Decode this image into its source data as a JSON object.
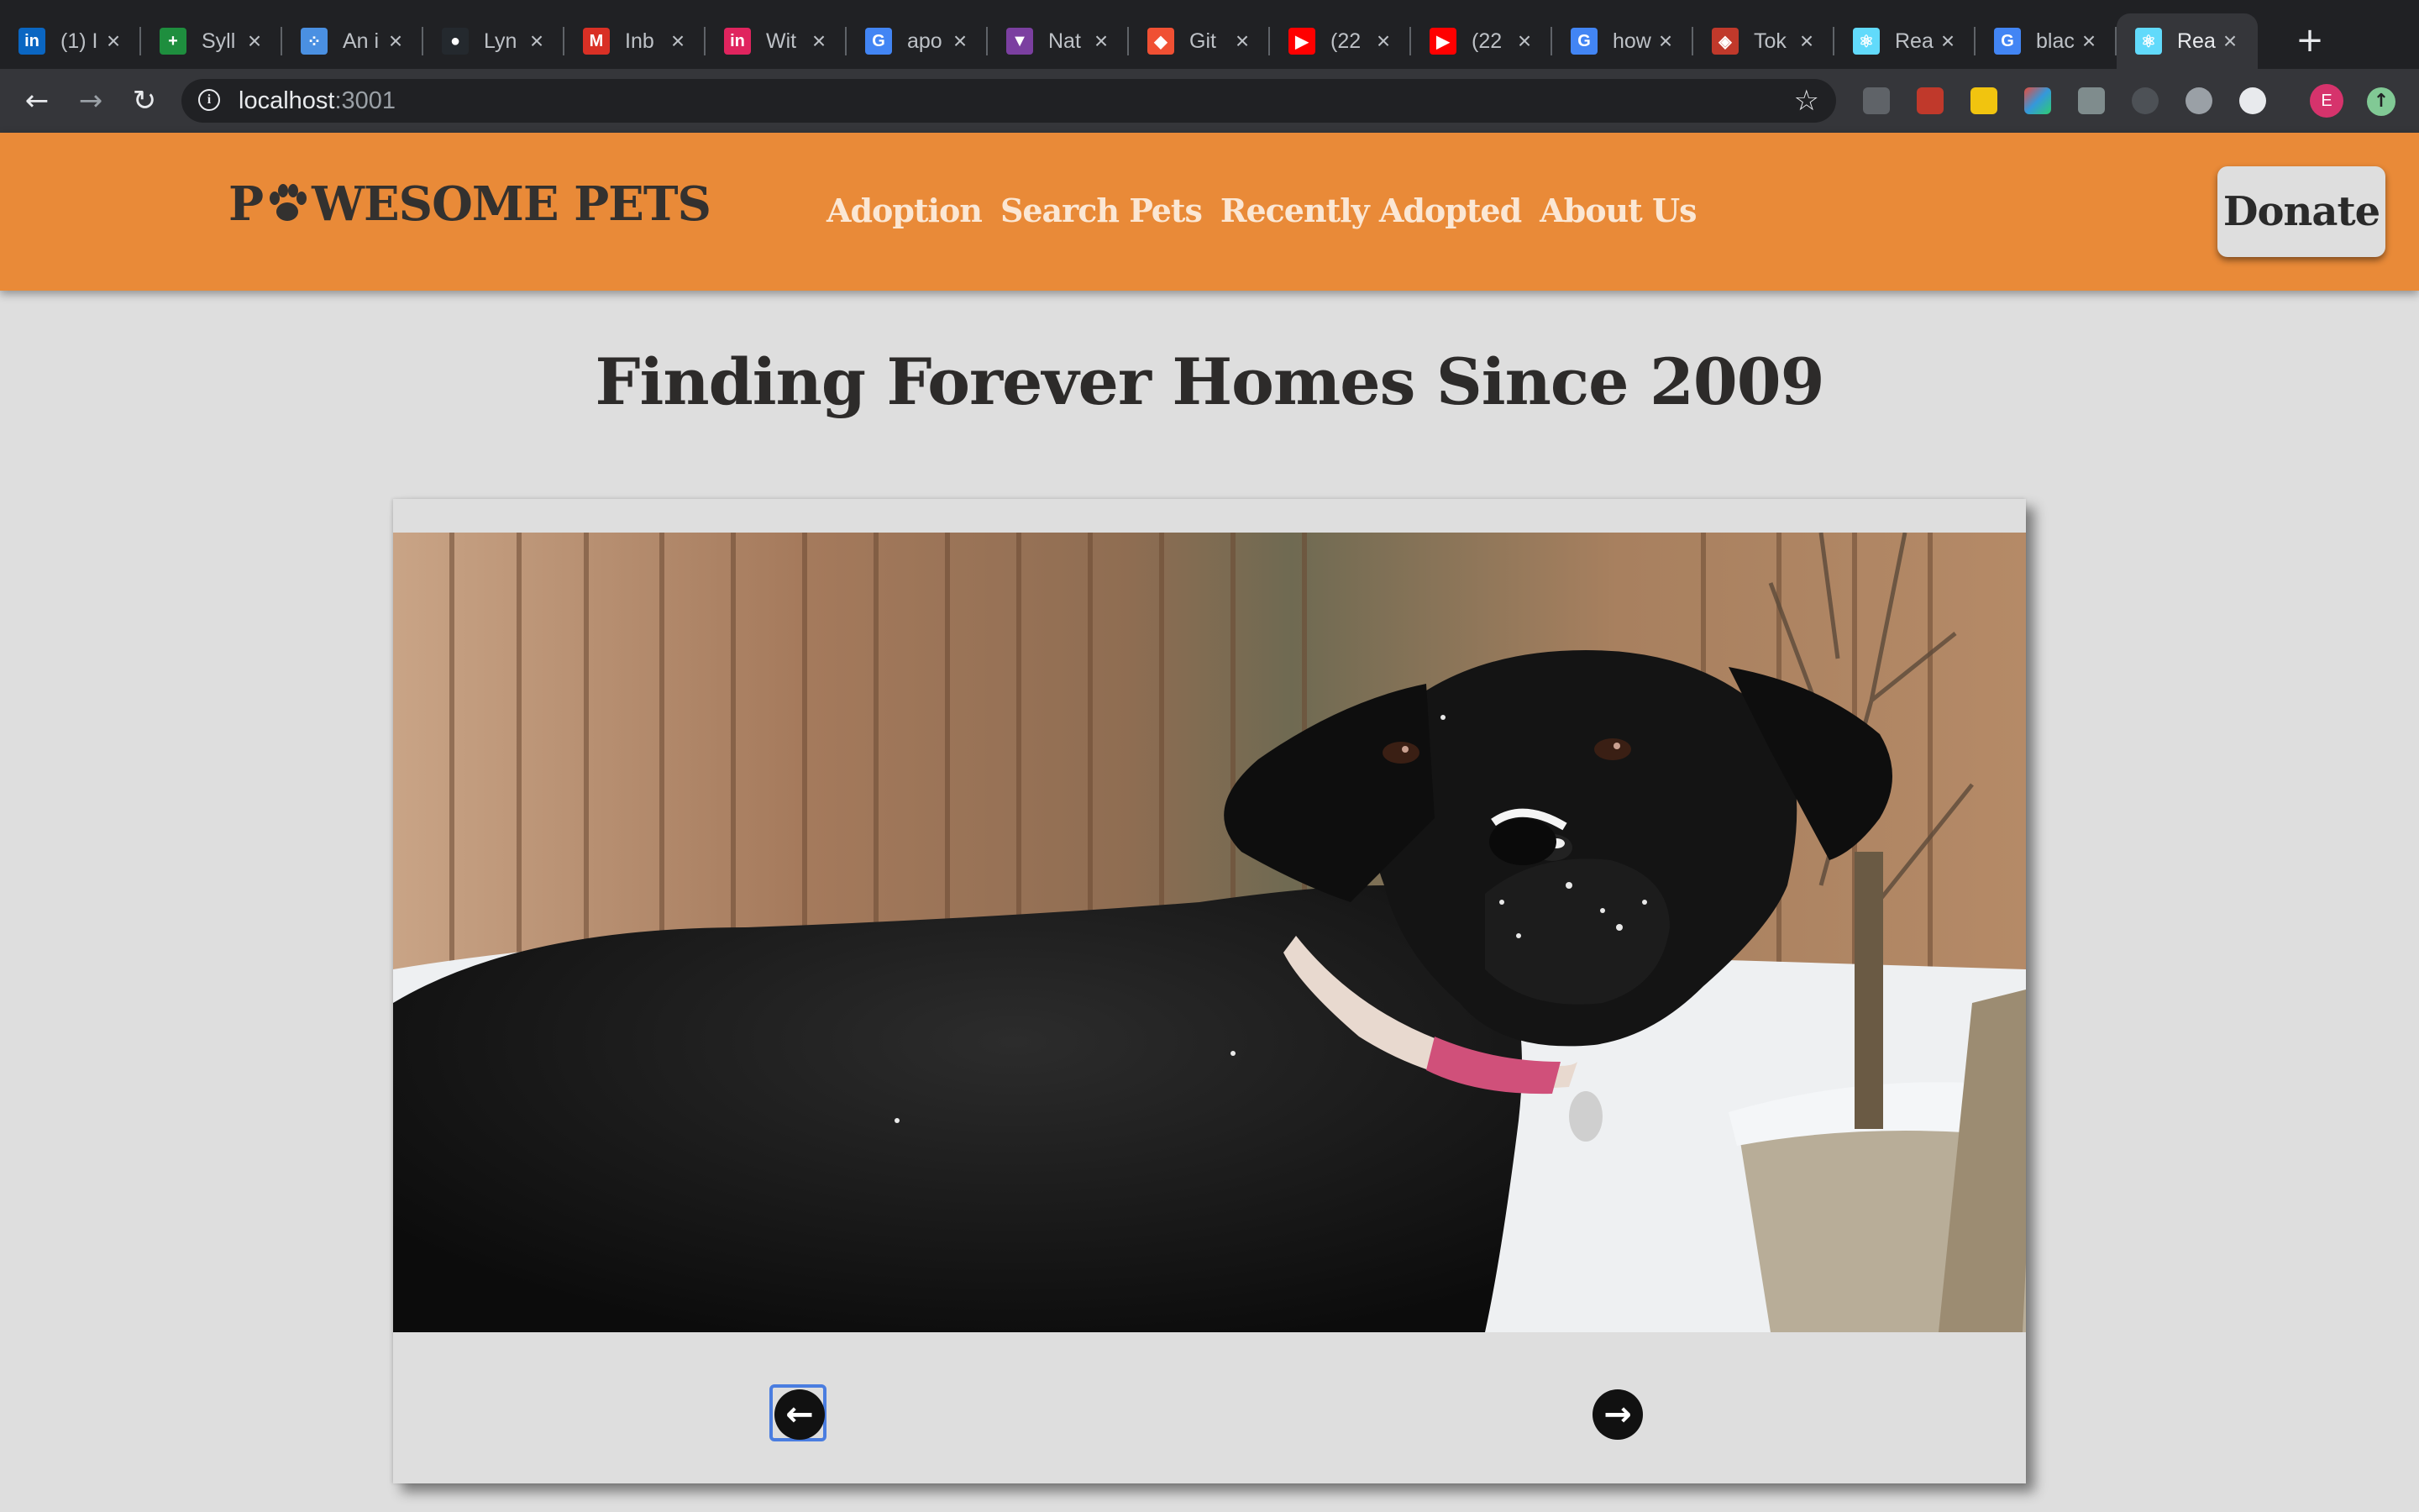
{
  "browser": {
    "tabs": [
      {
        "title": "(1) I",
        "icon": "linkedin-icon",
        "color": "#0a66c2",
        "glyph": "in"
      },
      {
        "title": "Syll",
        "icon": "google-sheets-icon",
        "color": "#1e8e3e",
        "glyph": "+"
      },
      {
        "title": "An i",
        "icon": "atom-dots-icon",
        "color": "#4a90e2",
        "glyph": "⁘"
      },
      {
        "title": "Lyn",
        "icon": "github-icon",
        "color": "#24292e",
        "glyph": "●"
      },
      {
        "title": "Inb",
        "icon": "gmail-icon",
        "color": "#d93025",
        "glyph": "M"
      },
      {
        "title": "Wit",
        "icon": "invision-icon",
        "color": "#e0245e",
        "glyph": "in"
      },
      {
        "title": "apo",
        "icon": "google-icon",
        "color": "#4285f4",
        "glyph": "G"
      },
      {
        "title": "Nat",
        "icon": "shield-icon",
        "color": "#7b3fa0",
        "glyph": "▼"
      },
      {
        "title": "Git",
        "icon": "git-icon",
        "color": "#f05033",
        "glyph": "◆"
      },
      {
        "title": "(22",
        "icon": "youtube-icon",
        "color": "#ff0000",
        "glyph": "▶"
      },
      {
        "title": "(22",
        "icon": "youtube-icon",
        "color": "#ff0000",
        "glyph": "▶"
      },
      {
        "title": "how",
        "icon": "google-icon",
        "color": "#4285f4",
        "glyph": "G"
      },
      {
        "title": "Tok",
        "icon": "diamond-icon",
        "color": "#c0392b",
        "glyph": "◈"
      },
      {
        "title": "Rea",
        "icon": "react-icon",
        "color": "#61dafb",
        "glyph": "⚛"
      },
      {
        "title": "blac",
        "icon": "google-icon",
        "color": "#4285f4",
        "glyph": "G"
      },
      {
        "title": "Rea",
        "icon": "react-icon",
        "color": "#61dafb",
        "glyph": "⚛",
        "active": true
      }
    ],
    "url_host": "localhost",
    "url_port": ":3001",
    "avatar_letter": "E"
  },
  "site": {
    "logo_prefix": "P",
    "logo_suffix": "WESOME PETS",
    "nav": [
      "Adoption",
      "Search Pets",
      "Recently Adopted",
      "About Us"
    ],
    "donate_label": "Donate",
    "accent_color": "#e98a38"
  },
  "main": {
    "title": "Finding Forever Homes Since 2009",
    "carousel": {
      "photo": "black-labrador-dog-in-snow",
      "prev_icon": "arrow-left-icon",
      "next_icon": "arrow-right-icon"
    }
  }
}
